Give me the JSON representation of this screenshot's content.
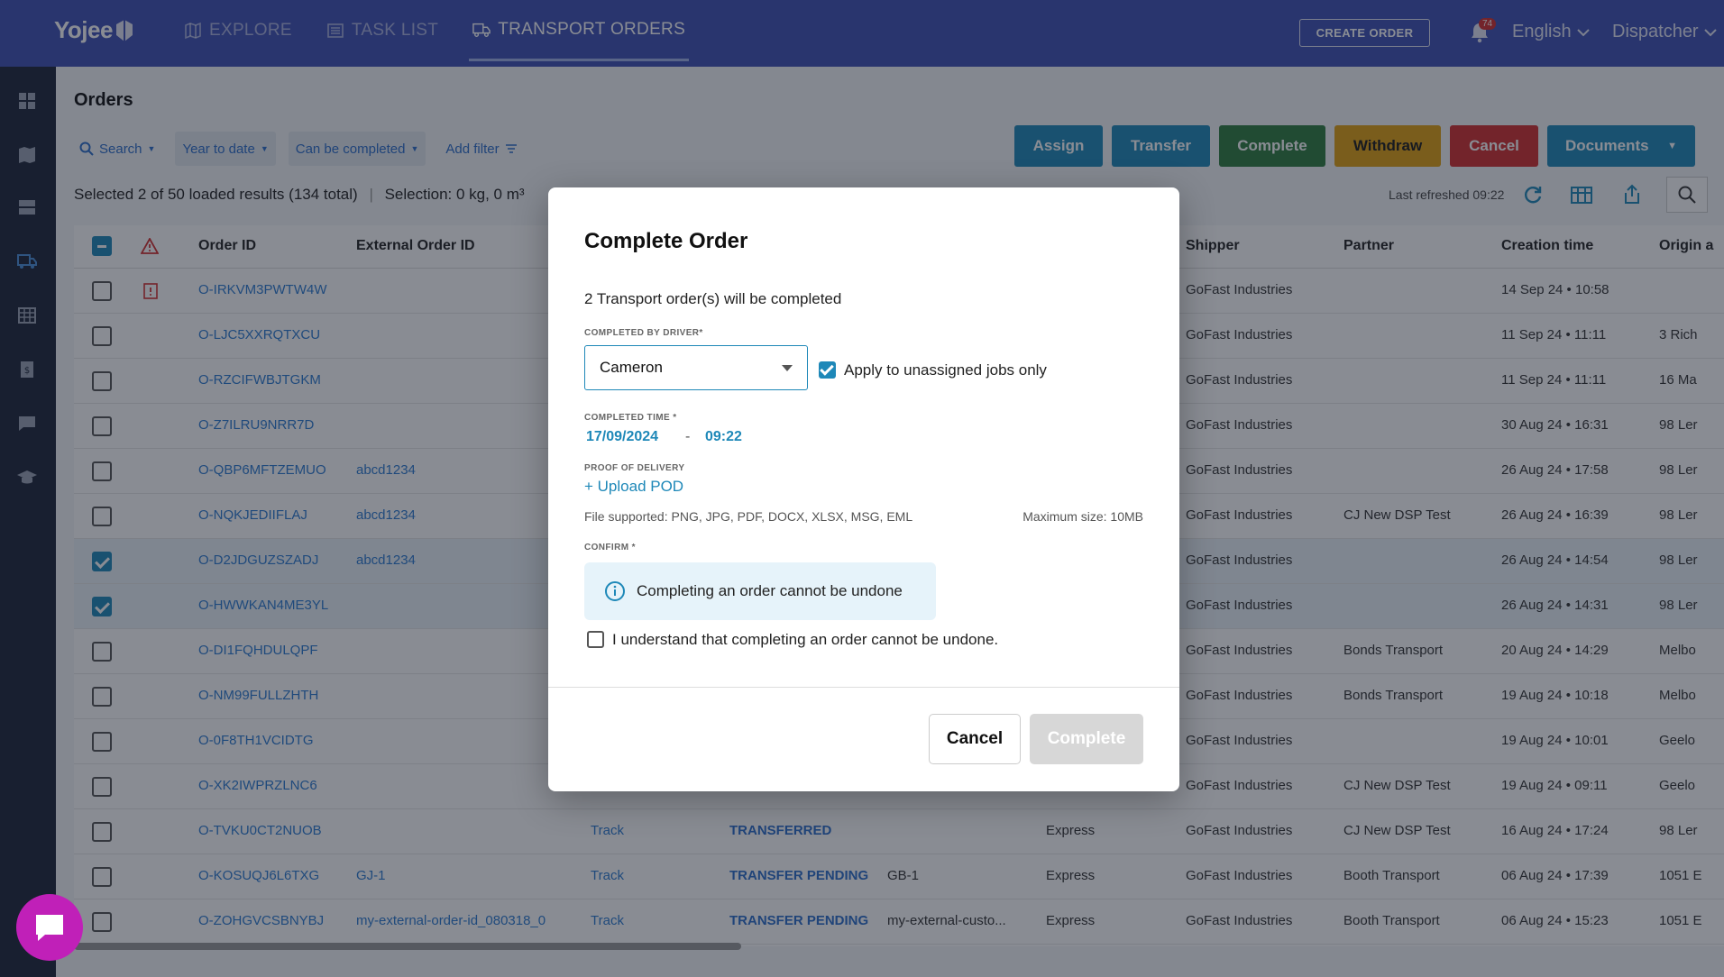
{
  "app": {
    "logo": "Yojee"
  },
  "nav": {
    "explore": "EXPLORE",
    "task_list": "TASK LIST",
    "transport_orders": "TRANSPORT ORDERS",
    "create_order": "CREATE ORDER",
    "notif_count": "74",
    "language": "English",
    "role": "Dispatcher"
  },
  "page": {
    "title": "Orders",
    "filters": {
      "search": "Search",
      "period": "Year to date",
      "state": "Can be completed",
      "add_filter": "Add filter"
    },
    "actions": {
      "assign": "Assign",
      "transfer": "Transfer",
      "complete": "Complete",
      "withdraw": "Withdraw",
      "cancel": "Cancel",
      "documents": "Documents"
    },
    "selection": "Selected 2 of 50 loaded results (134 total)",
    "selection_weight": "Selection: 0 kg, 0 m³",
    "refreshed": "Last refreshed 09:22"
  },
  "table": {
    "headers": {
      "order_id": "Order ID",
      "external_order_id": "External Order ID",
      "shipper": "Shipper",
      "partner": "Partner",
      "creation_time": "Creation time",
      "origin": "Origin a"
    },
    "rows": [
      {
        "id": "O-IRKVM3PWTW4W",
        "ext": "",
        "track": "",
        "status": "",
        "ref": "",
        "service": "",
        "shipper": "GoFast Industries",
        "partner": "",
        "time": "14 Sep 24 • 10:58",
        "origin": "",
        "checked": false,
        "warn": true
      },
      {
        "id": "O-LJC5XXRQTXCU",
        "ext": "",
        "track": "",
        "status": "",
        "ref": "",
        "service": "",
        "shipper": "GoFast Industries",
        "partner": "",
        "time": "11 Sep 24 • 11:11",
        "origin": "3 Rich",
        "checked": false,
        "warn": false
      },
      {
        "id": "O-RZCIFWBJTGKM",
        "ext": "",
        "track": "",
        "status": "",
        "ref": "",
        "service": "",
        "shipper": "GoFast Industries",
        "partner": "",
        "time": "11 Sep 24 • 11:11",
        "origin": "16 Ma",
        "checked": false,
        "warn": false
      },
      {
        "id": "O-Z7ILRU9NRR7D",
        "ext": "",
        "track": "",
        "status": "",
        "ref": "",
        "service": "",
        "shipper": "GoFast Industries",
        "partner": "",
        "time": "30 Aug 24 • 16:31",
        "origin": "98 Ler",
        "checked": false,
        "warn": false
      },
      {
        "id": "O-QBP6MFTZEMUO",
        "ext": "abcd1234",
        "track": "",
        "status": "",
        "ref": "",
        "service": "",
        "shipper": "GoFast Industries",
        "partner": "",
        "time": "26 Aug 24 • 17:58",
        "origin": "98 Ler",
        "checked": false,
        "warn": false
      },
      {
        "id": "O-NQKJEDIIFLAJ",
        "ext": "abcd1234",
        "track": "",
        "status": "",
        "ref": "",
        "service": "",
        "shipper": "GoFast Industries",
        "partner": "CJ New DSP Test",
        "time": "26 Aug 24 • 16:39",
        "origin": "98 Ler",
        "checked": false,
        "warn": false
      },
      {
        "id": "O-D2JDGUZSZADJ",
        "ext": "abcd1234",
        "track": "",
        "status": "",
        "ref": "",
        "service": "",
        "shipper": "GoFast Industries",
        "partner": "",
        "time": "26 Aug 24 • 14:54",
        "origin": "98 Ler",
        "checked": true,
        "warn": false
      },
      {
        "id": "O-HWWKAN4ME3YL",
        "ext": "",
        "track": "",
        "status": "",
        "ref": "",
        "service": "",
        "shipper": "GoFast Industries",
        "partner": "",
        "time": "26 Aug 24 • 14:31",
        "origin": "98 Ler",
        "checked": true,
        "warn": false
      },
      {
        "id": "O-DI1FQHDULQPF",
        "ext": "",
        "track": "",
        "status": "",
        "ref": "",
        "service": "",
        "shipper": "GoFast Industries",
        "partner": "Bonds Transport",
        "time": "20 Aug 24 • 14:29",
        "origin": "Melbo",
        "checked": false,
        "warn": false
      },
      {
        "id": "O-NM99FULLZHTH",
        "ext": "",
        "track": "",
        "status": "",
        "ref": "",
        "service": "",
        "shipper": "GoFast Industries",
        "partner": "Bonds Transport",
        "time": "19 Aug 24 • 10:18",
        "origin": "Melbo",
        "checked": false,
        "warn": false
      },
      {
        "id": "O-0F8TH1VCIDTG",
        "ext": "",
        "track": "",
        "status": "",
        "ref": "",
        "service": "",
        "shipper": "GoFast Industries",
        "partner": "",
        "time": "19 Aug 24 • 10:01",
        "origin": "Geelo",
        "checked": false,
        "warn": false
      },
      {
        "id": "O-XK2IWPRZLNC6",
        "ext": "",
        "track": "",
        "status": "",
        "ref": "",
        "service": "",
        "shipper": "GoFast Industries",
        "partner": "CJ New DSP Test",
        "time": "19 Aug 24 • 09:11",
        "origin": "Geelo",
        "checked": false,
        "warn": false
      },
      {
        "id": "O-TVKU0CT2NUOB",
        "ext": "",
        "track": "Track",
        "status": "TRANSFERRED",
        "ref": "",
        "service": "Express",
        "shipper": "GoFast Industries",
        "partner": "CJ New DSP Test",
        "time": "16 Aug 24 • 17:24",
        "origin": "98 Ler",
        "checked": false,
        "warn": false
      },
      {
        "id": "O-KOSUQJ6L6TXG",
        "ext": "GJ-1",
        "track": "Track",
        "status": "TRANSFER PENDING",
        "ref": "GB-1",
        "service": "Express",
        "shipper": "GoFast Industries",
        "partner": "Booth Transport",
        "time": "06 Aug 24 • 17:39",
        "origin": "1051 E",
        "checked": false,
        "warn": false
      },
      {
        "id": "O-ZOHGVCSBNYBJ",
        "ext": "my-external-order-id_080318_0",
        "track": "Track",
        "status": "TRANSFER PENDING",
        "ref": "my-external-custo...",
        "service": "Express",
        "shipper": "GoFast Industries",
        "partner": "Booth Transport",
        "time": "06 Aug 24 • 15:23",
        "origin": "1051 E",
        "checked": false,
        "warn": false
      }
    ]
  },
  "modal": {
    "title": "Complete Order",
    "summary": "2 Transport order(s) will be completed",
    "driver_label": "COMPLETED BY DRIVER*",
    "driver_value": "Cameron",
    "apply_label": "Apply to unassigned jobs only",
    "time_label": "COMPLETED TIME *",
    "date": "17/09/2024",
    "date_sep": "-",
    "time": "09:22",
    "pod_label": "PROOF OF DELIVERY",
    "upload": "+ Upload POD",
    "file_supported": "File supported: PNG, JPG, PDF, DOCX, XLSX, MSG, EML",
    "max_size": "Maximum size: 10MB",
    "confirm_label": "CONFIRM *",
    "info": "Completing an order cannot be undone",
    "understand": "I understand that completing an order cannot be undone.",
    "cancel": "Cancel",
    "complete": "Complete"
  },
  "colors": {
    "topbar": "#3f51b5",
    "sidebar": "#1c2538",
    "accent": "#1e88b8",
    "complete": "#2e7d3e",
    "withdraw": "#e0a010",
    "cancel": "#d32f2f",
    "chat": "#c020b8"
  }
}
